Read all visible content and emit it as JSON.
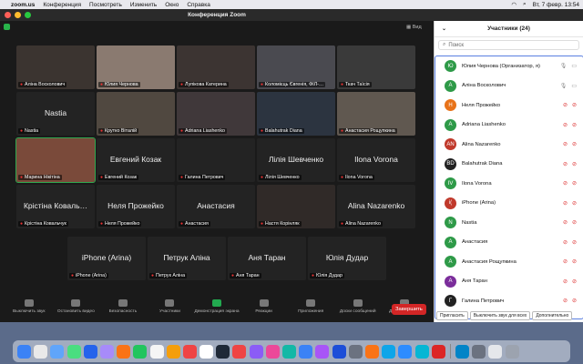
{
  "menubar": {
    "app": "zoom.us",
    "items": [
      "Конференция",
      "Посмотреть",
      "Изменить",
      "Окно",
      "Справка"
    ],
    "clock": "Вт, 7 февр.  13:54"
  },
  "window": {
    "title": "Конференция Zoom",
    "view_label": "Вид"
  },
  "tiles": [
    {
      "label": "Аліна Восколович",
      "big": ""
    },
    {
      "label": "Юлия Чернова",
      "big": ""
    },
    {
      "label": "Лупікова Катерина",
      "big": ""
    },
    {
      "label": "Коломієць Євгенія, ФІЛ-…",
      "big": ""
    },
    {
      "label": "Ткач Таїсія",
      "big": ""
    },
    {
      "label": "Nastia",
      "big": "Nastia"
    },
    {
      "label": "Крутко Віталій",
      "big": ""
    },
    {
      "label": "Adriana Liashenko",
      "big": ""
    },
    {
      "label": "Balahutrak Diana",
      "big": ""
    },
    {
      "label": "Анастасия Рощупкина",
      "big": ""
    },
    {
      "label": "Марина Нікітіна",
      "big": ""
    },
    {
      "label": "Евгений Козак",
      "big": "Евгений Козак"
    },
    {
      "label": "Галина Петрович",
      "big": ""
    },
    {
      "label": "Лілія Шевченко",
      "big": "Лілія Шевченко"
    },
    {
      "label": "Ilona Vorona",
      "big": "Ilona Vorona"
    },
    {
      "label": "Крістіна Ковальчук",
      "big": "Крістіна Коваль…"
    },
    {
      "label": "Неля Прожейко",
      "big": "Неля Прожейко"
    },
    {
      "label": "Анастасия",
      "big": "Анастасия"
    },
    {
      "label": "Настя Корінляк",
      "big": ""
    },
    {
      "label": "Alina Nazarenko",
      "big": "Alina Nazarenko"
    },
    {
      "label": "iPhone (Arina)",
      "big": "iPhone (Arina)"
    },
    {
      "label": "Петрук Аліна",
      "big": "Петрук Аліна"
    },
    {
      "label": "Аня Таран",
      "big": "Аня Таран"
    },
    {
      "label": "Юлія Дудар",
      "big": "Юлія Дудар"
    }
  ],
  "toolbar": {
    "items": [
      "Выключить звук",
      "Остановить видео",
      "Безопасность",
      "Участники",
      "Демонстрация экрана",
      "Реакции",
      "Приложения",
      "Доски сообщений",
      "Дополнительно"
    ],
    "end_label": "Завершить"
  },
  "participants_panel": {
    "title": "Участники (24)",
    "search_placeholder": "Поиск",
    "rows": [
      {
        "initials": "Ю",
        "name": "Юлия Чернова (Организатор, я)",
        "color": "#2e9a48"
      },
      {
        "initials": "А",
        "name": "Аліна Восколович",
        "color": "#2e9a48"
      },
      {
        "initials": "Н",
        "name": "Неля Прожейко",
        "color": "#e8731a"
      },
      {
        "initials": "A",
        "name": "Adriana Liashenko",
        "color": "#2e9a48"
      },
      {
        "initials": "AN",
        "name": "Alina Nazarenko",
        "color": "#c0392b"
      },
      {
        "initials": "BD",
        "name": "Balahutrak Diana",
        "color": "#222222"
      },
      {
        "initials": "IV",
        "name": "Ilona Vorona",
        "color": "#2e9a48"
      },
      {
        "initials": "i(",
        "name": "iPhone (Arina)",
        "color": "#c0392b"
      },
      {
        "initials": "N",
        "name": "Nastia",
        "color": "#2e9a48"
      },
      {
        "initials": "А",
        "name": "Анастасия",
        "color": "#2e9a48"
      },
      {
        "initials": "А",
        "name": "Анастасия Рощупкина",
        "color": "#2e9a48"
      },
      {
        "initials": "А",
        "name": "Аня Таран",
        "color": "#7b2d9b"
      },
      {
        "initials": "Г",
        "name": "Галина Петрович",
        "color": "#222222"
      }
    ],
    "footer": {
      "invite": "Пригласить",
      "mute_all": "Выключить звук для всех",
      "more": "Дополнительно"
    }
  },
  "colors": {
    "accent_green": "#22a94f",
    "end_red": "#d32626",
    "highlight_blue": "#5a7fe0"
  }
}
